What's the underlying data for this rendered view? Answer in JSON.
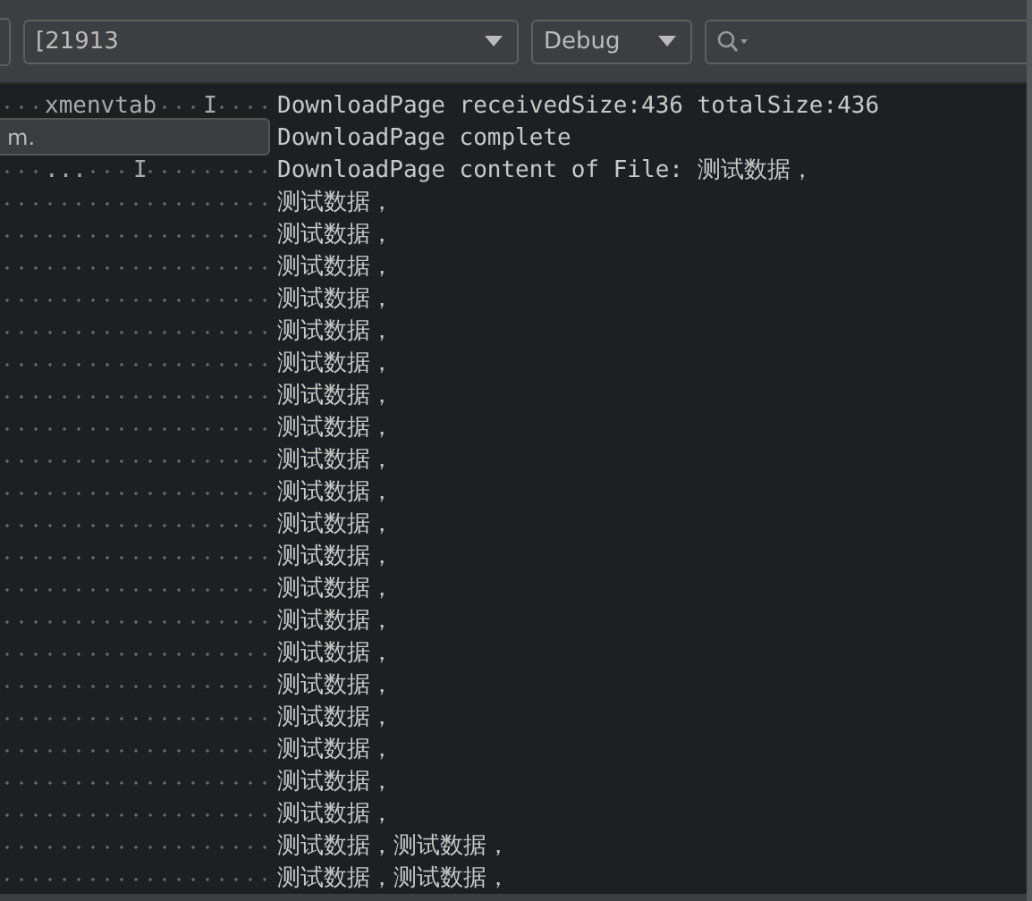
{
  "toolbar": {
    "process_dropdown": {
      "value": "[21913"
    },
    "level_dropdown": {
      "value": "Debug"
    }
  },
  "tooltip": {
    "text": "m."
  },
  "log_lines": [
    {
      "tag": "xmenvtab",
      "level": "I",
      "message": "DownloadPage receivedSize:436 totalSize:436"
    },
    {
      "message": "DownloadPage complete"
    },
    {
      "tag": "...",
      "level": "I",
      "message": "DownloadPage content of File: 测试数据，"
    },
    {
      "message": "测试数据，"
    },
    {
      "message": "测试数据，"
    },
    {
      "message": "测试数据，"
    },
    {
      "message": "测试数据，"
    },
    {
      "message": "测试数据，"
    },
    {
      "message": "测试数据，"
    },
    {
      "message": "测试数据，"
    },
    {
      "message": "测试数据，"
    },
    {
      "message": "测试数据，"
    },
    {
      "message": "测试数据，"
    },
    {
      "message": "测试数据，"
    },
    {
      "message": "测试数据，"
    },
    {
      "message": "测试数据，"
    },
    {
      "message": "测试数据，"
    },
    {
      "message": "测试数据，"
    },
    {
      "message": "测试数据，"
    },
    {
      "message": "测试数据，"
    },
    {
      "message": "测试数据，"
    },
    {
      "message": "测试数据，"
    },
    {
      "message": "测试数据，"
    },
    {
      "message": "测试数据，测试数据，"
    },
    {
      "message": "测试数据，测试数据，"
    }
  ]
}
